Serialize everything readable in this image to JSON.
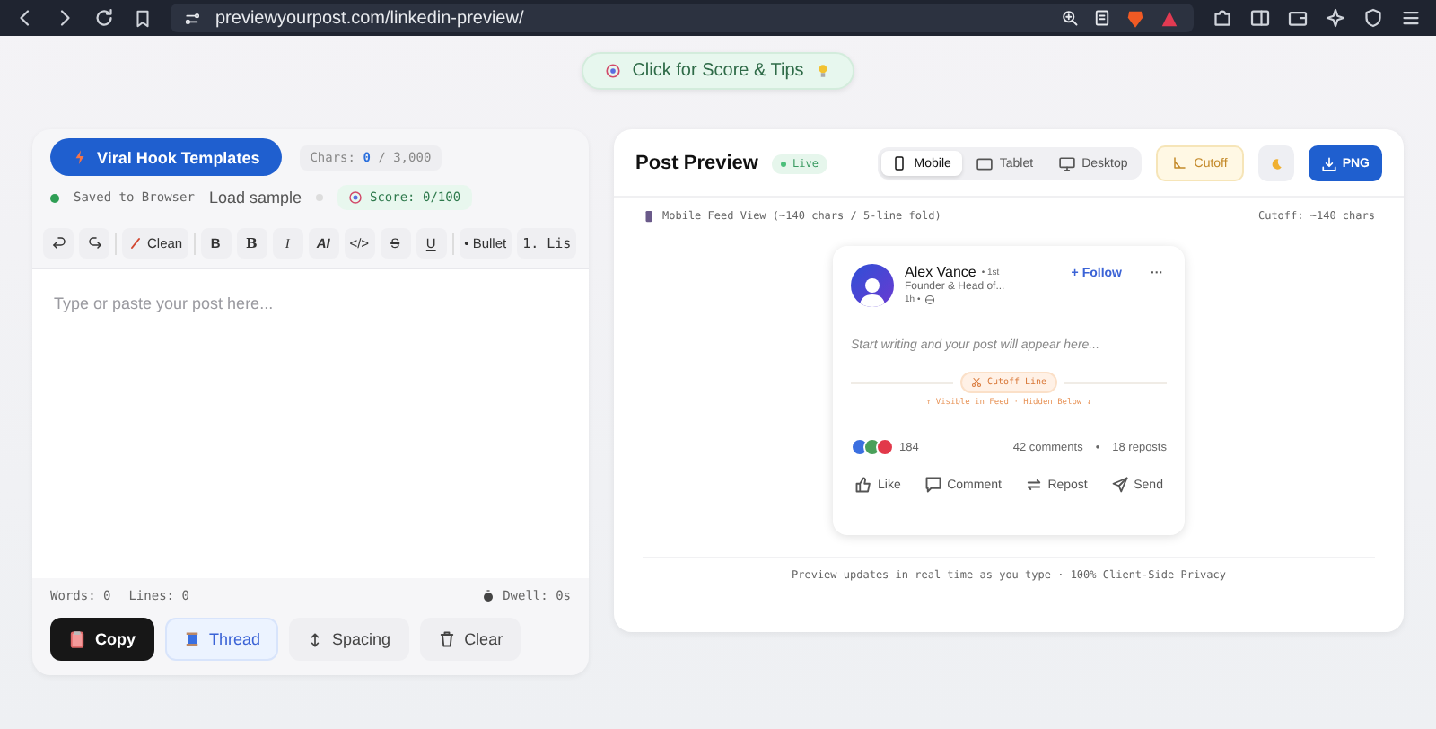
{
  "browser": {
    "url": "previewyourpost.com/linkedin-preview/"
  },
  "score_tips": {
    "label": "Click for Score & Tips"
  },
  "editor": {
    "templates_button": "Viral Hook Templates",
    "chars_label": "Chars:",
    "chars_count": "0",
    "chars_max": "/ 3,000",
    "saved_status": "Saved to Browser",
    "load_sample": "Load sample",
    "score": "Score: 0/100",
    "toolbar": [
      {
        "kind": "undo"
      },
      {
        "kind": "redo"
      },
      {
        "kind": "clean",
        "label": "Clean"
      },
      {
        "kind": "bold",
        "label": "B"
      },
      {
        "kind": "bold-serif",
        "label": "B"
      },
      {
        "kind": "italic",
        "label": "I"
      },
      {
        "kind": "bold-italic",
        "label": "AI"
      },
      {
        "kind": "code",
        "label": "</>"
      },
      {
        "kind": "strike",
        "label": "S"
      },
      {
        "kind": "underline",
        "label": "U"
      },
      {
        "kind": "bullet",
        "label": "• Bullet"
      },
      {
        "kind": "list",
        "label": "1. Lis"
      }
    ],
    "placeholder": "Type or paste your post here...",
    "words": "Words: 0",
    "lines": "Lines: 0",
    "dwell": "Dwell: 0s",
    "actions": [
      {
        "kind": "copy",
        "label": "Copy"
      },
      {
        "kind": "thread",
        "label": "Thread"
      },
      {
        "kind": "spacing",
        "label": "Spacing"
      },
      {
        "kind": "clear",
        "label": "Clear"
      }
    ]
  },
  "preview": {
    "title": "Post Preview",
    "live_badge": "Live",
    "devices": [
      {
        "kind": "mobile",
        "label": "Mobile",
        "selected": true
      },
      {
        "kind": "tablet",
        "label": "Tablet",
        "selected": false
      },
      {
        "kind": "desktop",
        "label": "Desktop",
        "selected": false
      }
    ],
    "cutoff_button": "Cutoff",
    "png_button": "PNG",
    "view_label": "Mobile Feed View (~140 chars / 5-line fold)",
    "cutoff_info": "Cutoff: ~140 chars",
    "post": {
      "author": "Alex Vance",
      "degree": "• 1st",
      "headline": "Founder & Head of...",
      "time": "1h •",
      "follow": "+ Follow",
      "more": "···",
      "body_placeholder": "Start writing and your post will appear here...",
      "cutoff_line": "Cutoff Line",
      "cutoff_hint": "↑ Visible in Feed · Hidden Below ↓",
      "reactions": "184",
      "comments": "42 comments",
      "separator": "•",
      "reposts": "18 reposts",
      "actions": [
        {
          "kind": "like",
          "label": "Like"
        },
        {
          "kind": "comment",
          "label": "Comment"
        },
        {
          "kind": "repost",
          "label": "Repost"
        },
        {
          "kind": "send",
          "label": "Send"
        }
      ]
    },
    "footer": "Preview updates in real time as you type · 100% Client-Side Privacy"
  }
}
